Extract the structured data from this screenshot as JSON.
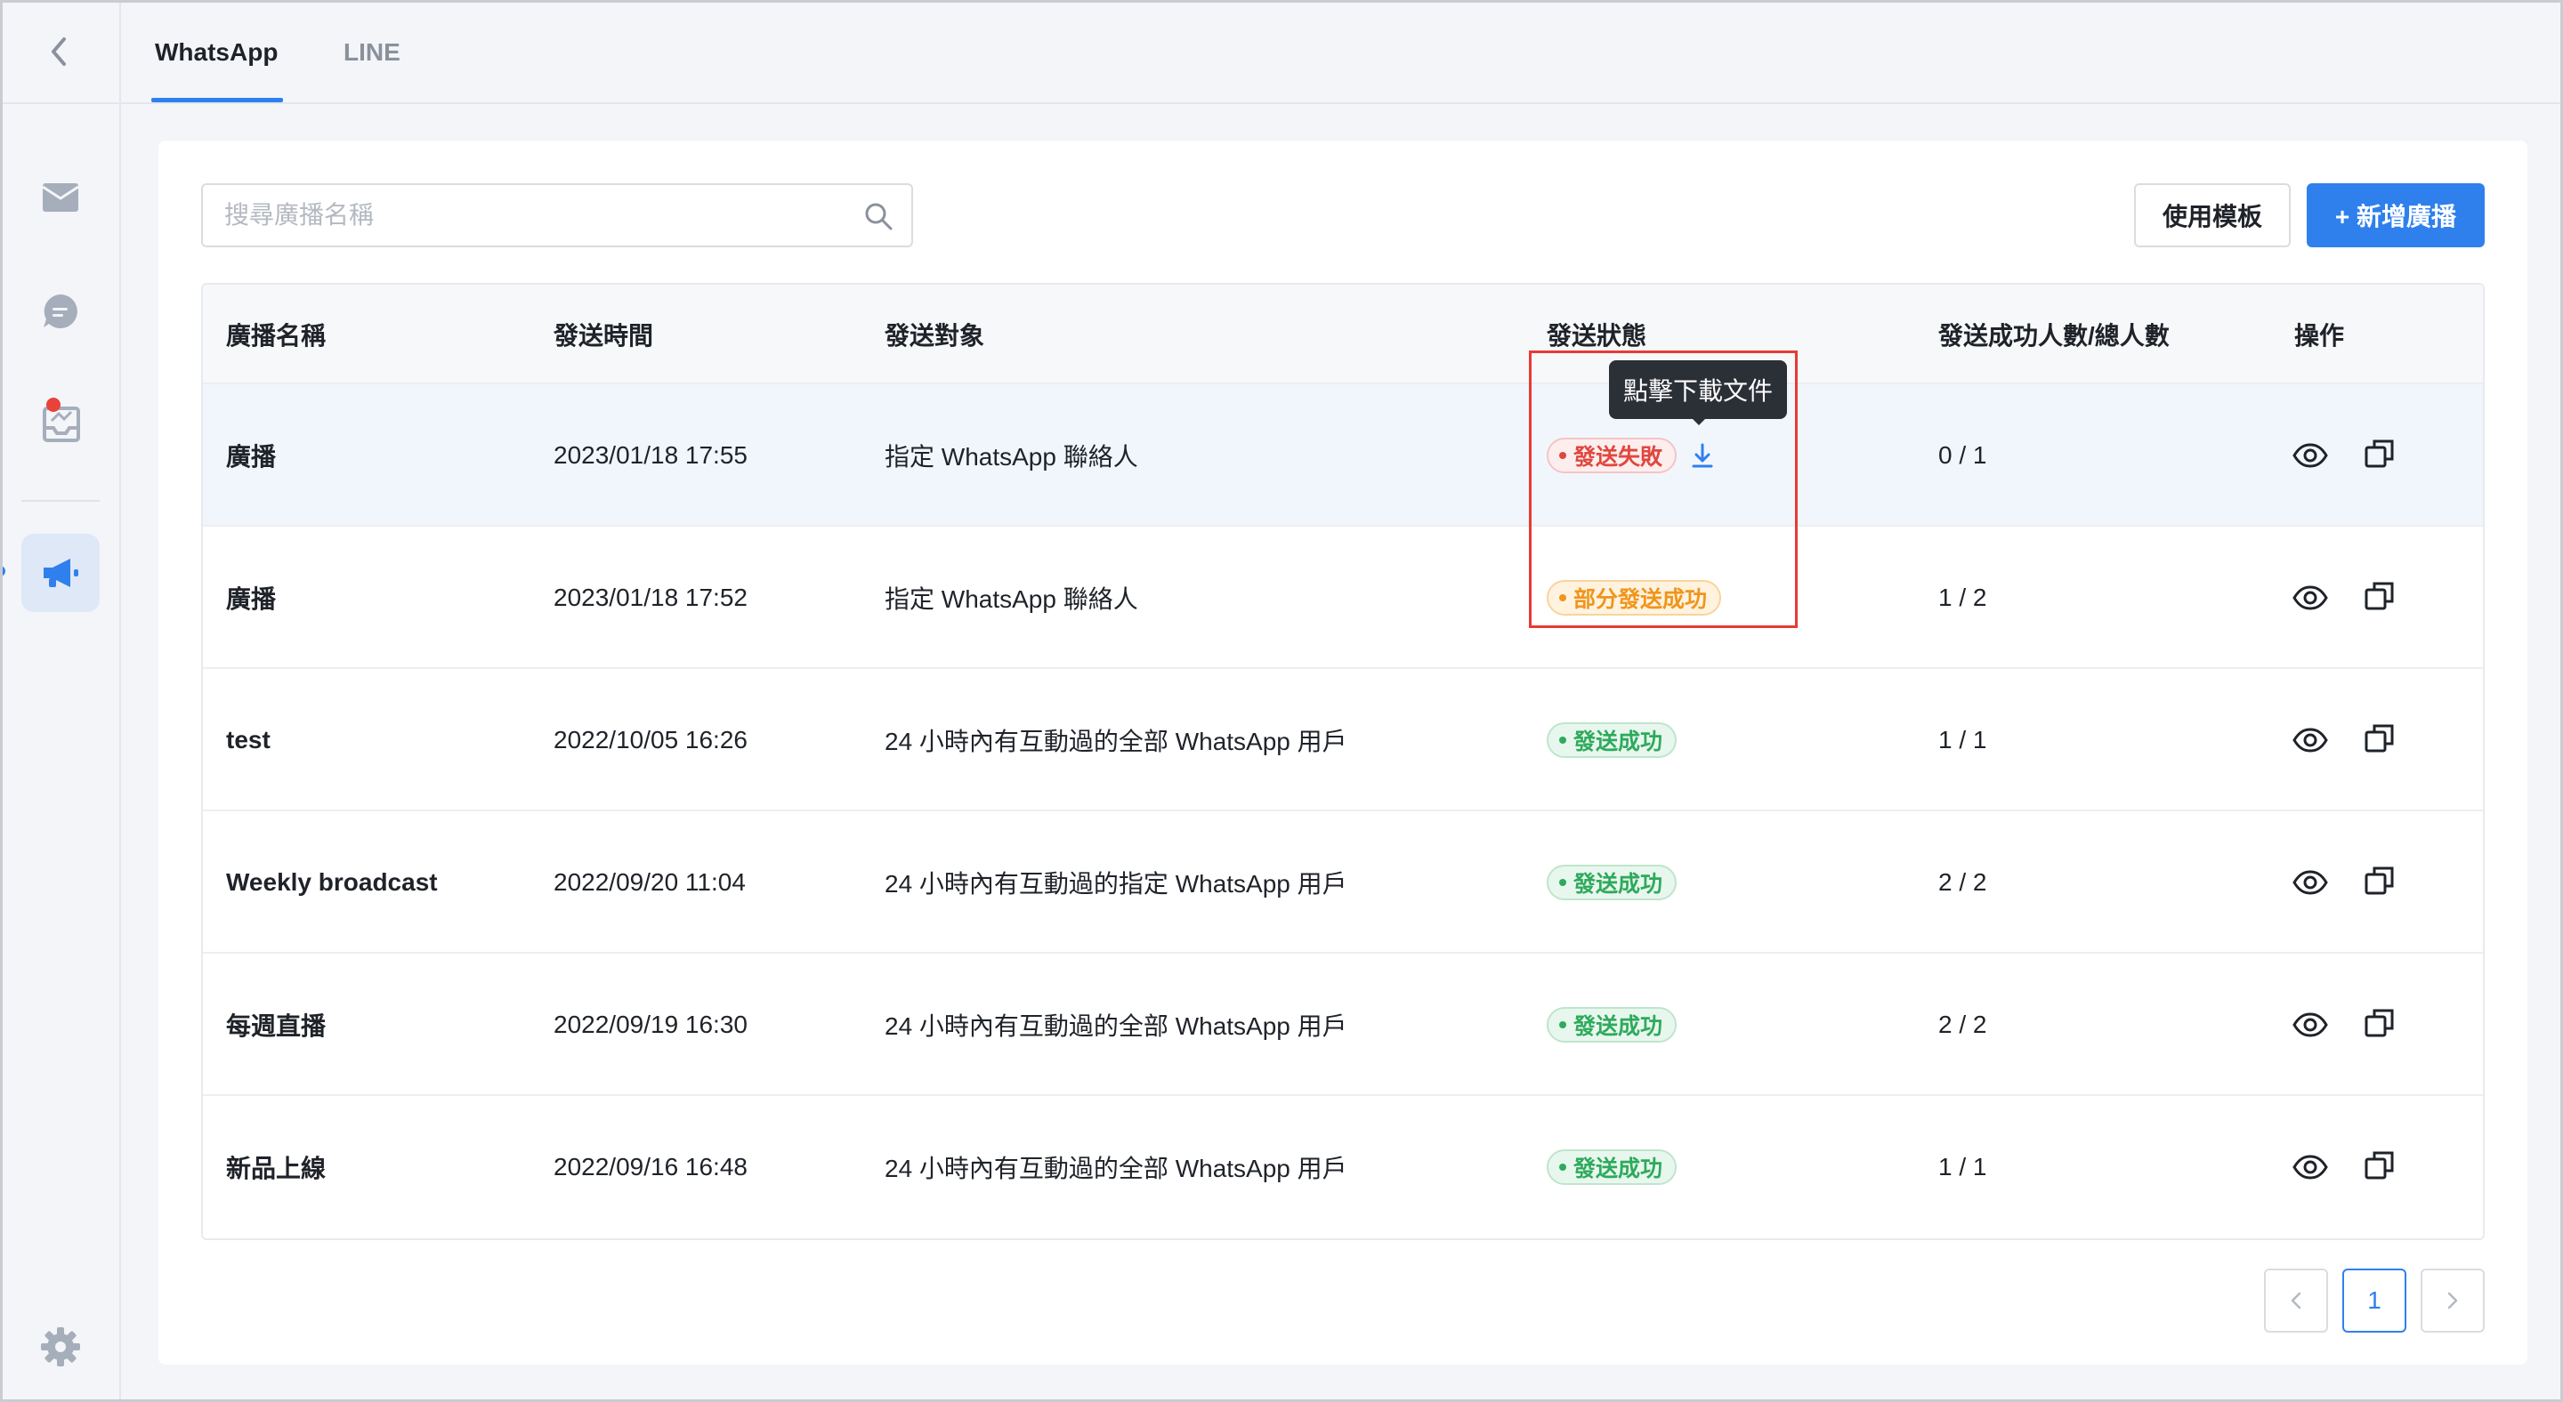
{
  "tabs": [
    {
      "label": "WhatsApp",
      "active": true
    },
    {
      "label": "LINE",
      "active": false
    }
  ],
  "sidebar": {
    "items": [
      {
        "icon": "mail-icon"
      },
      {
        "icon": "chat-bubble-icon"
      },
      {
        "icon": "inbox-notification-icon"
      },
      {
        "icon": "megaphone-icon",
        "active": true
      }
    ],
    "settings_icon": "gear-icon"
  },
  "toolbar": {
    "search_placeholder": "搜尋廣播名稱",
    "template_button": "使用模板",
    "new_button": "+ 新增廣播"
  },
  "table": {
    "columns": [
      "廣播名稱",
      "發送時間",
      "發送對象",
      "發送狀態",
      "發送成功人數/總人數",
      "操作"
    ],
    "rows": [
      {
        "name": "廣播",
        "time": "2023/01/18 17:55",
        "target": "指定 WhatsApp 聯絡人",
        "status": "發送失敗",
        "status_type": "fail",
        "count": "0 / 1",
        "downloadable": true
      },
      {
        "name": "廣播",
        "time": "2023/01/18 17:52",
        "target": "指定 WhatsApp 聯絡人",
        "status": "部分發送成功",
        "status_type": "partial",
        "count": "1 / 2"
      },
      {
        "name": "test",
        "time": "2022/10/05 16:26",
        "target": "24 小時內有互動過的全部 WhatsApp 用戶",
        "status": "發送成功",
        "status_type": "success",
        "count": "1 / 1"
      },
      {
        "name": "Weekly broadcast",
        "time": "2022/09/20 11:04",
        "target": "24 小時內有互動過的指定 WhatsApp 用戶",
        "status": "發送成功",
        "status_type": "success",
        "count": "2 / 2"
      },
      {
        "name": "每週直播",
        "time": "2022/09/19 16:30",
        "target": "24 小時內有互動過的全部 WhatsApp 用戶",
        "status": "發送成功",
        "status_type": "success",
        "count": "2 / 2"
      },
      {
        "name": "新品上線",
        "time": "2022/09/16 16:48",
        "target": "24 小時內有互動過的全部 WhatsApp 用戶",
        "status": "發送成功",
        "status_type": "success",
        "count": "1 / 1"
      }
    ]
  },
  "tooltip": "點擊下載文件",
  "pagination": {
    "prev": "<",
    "current": "1",
    "next": ">"
  },
  "colors": {
    "accent": "#2f80ed",
    "fail": "#e0473f",
    "partial": "#f0951c",
    "success": "#2eaa5c",
    "highlight": "#e63b34"
  }
}
